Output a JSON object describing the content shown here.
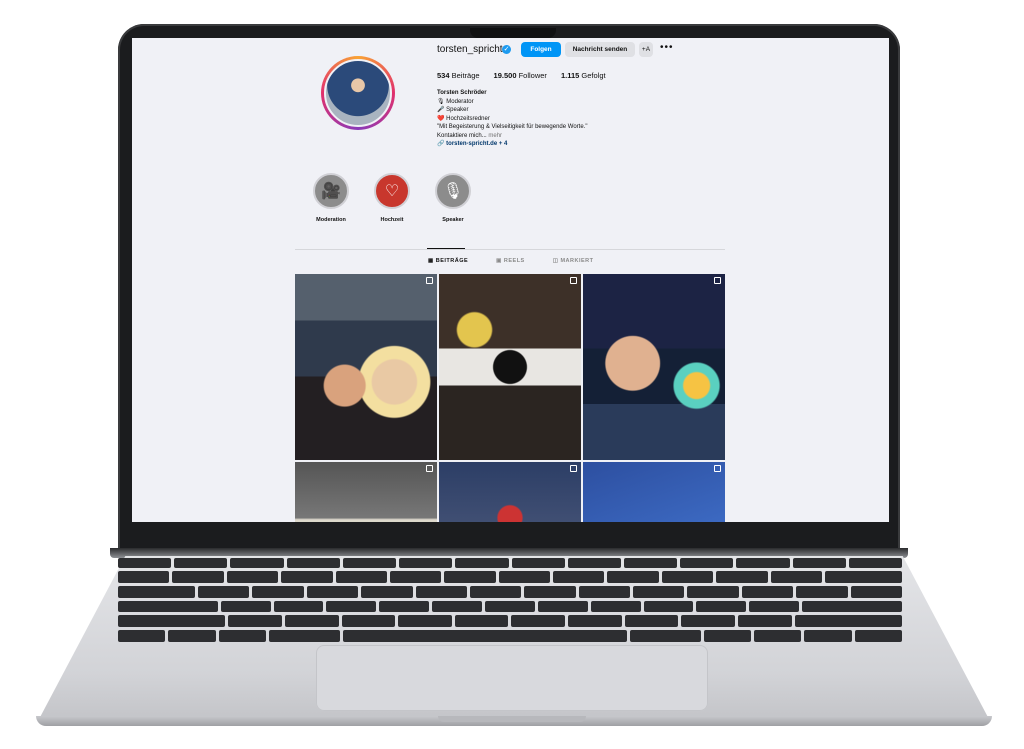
{
  "profile": {
    "username": "torsten_spricht",
    "follow_label": "Folgen",
    "message_label": "Nachricht senden",
    "add_label": "+A",
    "more_label": "•••",
    "stats": {
      "posts_count": "534",
      "posts_label": "Beiträge",
      "followers_count": "19.500",
      "followers_label": "Follower",
      "following_count": "1.115",
      "following_label": "Gefolgt"
    },
    "bio": {
      "name": "Torsten Schröder",
      "line1": "🎙 Moderator",
      "line2": "🎤 Speaker",
      "line3": "❤️ Hochzeitsredner",
      "quote": "\"Mit Begeisterung & Vielseitigkeit für bewegende Worte.\"",
      "contact": "Kontaktiere mich...",
      "more": "mehr",
      "link": "torsten-spricht.de",
      "link_extra": "+ 4"
    }
  },
  "highlights": [
    {
      "label": "Moderation",
      "icon": "camera-icon",
      "color": "#8c8c8c"
    },
    {
      "label": "Hochzeit",
      "icon": "heart-icon",
      "color": "#c8372d"
    },
    {
      "label": "Speaker",
      "icon": "microphone-icon",
      "color": "#8c8c8c"
    }
  ],
  "tabs": {
    "posts": "BEITRÄGE",
    "reels": "REELS",
    "tagged": "MARKIERT"
  },
  "colors": {
    "accent": "#0095f6",
    "verified": "#1d9bf0",
    "screen_bg": "#f0f1f6"
  }
}
